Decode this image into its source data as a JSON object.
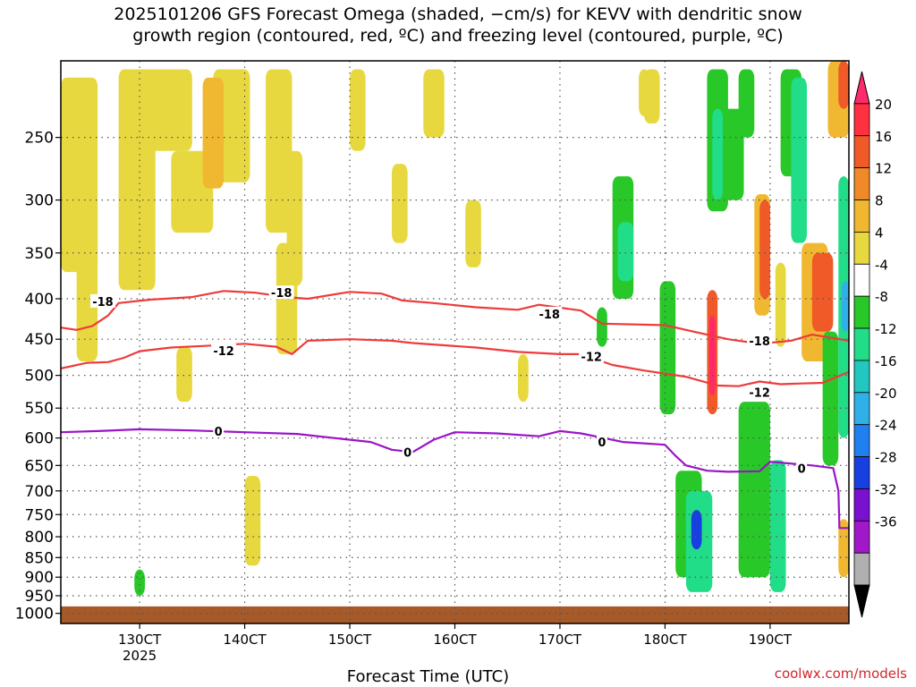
{
  "title": {
    "line1": "2025101206 GFS Forecast Omega (shaded, −cm/s) for KEVV with dendritic snow",
    "line2": "growth region (contoured, red, ºC) and freezing level (contoured, purple, ºC)"
  },
  "credit": "coolwx.com/models",
  "chart_data": {
    "type": "heatmap",
    "xlabel": "Forecast Time (UTC)",
    "x_ticks": [
      {
        "t": 30,
        "label": "130CT",
        "sub": "2025"
      },
      {
        "t": 40,
        "label": "140CT",
        "sub": ""
      },
      {
        "t": 50,
        "label": "150CT",
        "sub": ""
      },
      {
        "t": 60,
        "label": "160CT",
        "sub": ""
      },
      {
        "t": 70,
        "label": "170CT",
        "sub": ""
      },
      {
        "t": 80,
        "label": "180CT",
        "sub": ""
      },
      {
        "t": 90,
        "label": "190CT",
        "sub": ""
      }
    ],
    "x_range_days": [
      22.5,
      97.5
    ],
    "y_pressure_levels": [
      "250",
      "300",
      "350",
      "400",
      "450",
      "500",
      "550",
      "600",
      "650",
      "700",
      "750",
      "800",
      "850",
      "900",
      "950",
      "1000"
    ],
    "y_range_hpa": [
      200,
      1030
    ],
    "y_scale": "log-pressure",
    "colorbar": {
      "labels": [
        "20",
        "16",
        "12",
        "8",
        "4",
        "-4",
        "-8",
        "-12",
        "-16",
        "-20",
        "-24",
        "-28",
        "-32",
        "-36"
      ],
      "colors": [
        "#ff2a6a",
        "#ff3040",
        "#f05a28",
        "#f08a28",
        "#f0b830",
        "#e8d840",
        "#ffffff",
        "#28c828",
        "#22dd88",
        "#22c8c0",
        "#30b0e8",
        "#2080f0",
        "#1840e0",
        "#7a10d0",
        "#a018c8",
        "#b0b0b0",
        "#000000"
      ]
    },
    "contours": {
      "dendritic_minus18": {
        "label": "-18",
        "color": "#ee3b3b",
        "points": [
          [
            22.5,
            435
          ],
          [
            24,
            438
          ],
          [
            25.5,
            433
          ],
          [
            27,
            420
          ],
          [
            28,
            405
          ],
          [
            31,
            401
          ],
          [
            35,
            398
          ],
          [
            38,
            391
          ],
          [
            41,
            393
          ],
          [
            44,
            398
          ],
          [
            46,
            400
          ],
          [
            50,
            392
          ],
          [
            53,
            394
          ],
          [
            55,
            402
          ],
          [
            58,
            405
          ],
          [
            62,
            410
          ],
          [
            66,
            413
          ],
          [
            68,
            407
          ],
          [
            72,
            414
          ],
          [
            74,
            430
          ],
          [
            80,
            432
          ],
          [
            84,
            444
          ],
          [
            86,
            450
          ],
          [
            89,
            456
          ],
          [
            92,
            452
          ],
          [
            94,
            444
          ],
          [
            97.5,
            452
          ]
        ]
      },
      "dendritic_minus12": {
        "label": "-12",
        "color": "#ee3b3b",
        "points": [
          [
            22.5,
            490
          ],
          [
            25,
            482
          ],
          [
            27,
            481
          ],
          [
            28.5,
            475
          ],
          [
            30,
            466
          ],
          [
            33,
            461
          ],
          [
            36,
            459
          ],
          [
            40,
            456
          ],
          [
            43,
            460
          ],
          [
            44.5,
            470
          ],
          [
            46,
            452
          ],
          [
            50,
            450
          ],
          [
            54,
            452
          ],
          [
            56,
            455
          ],
          [
            62,
            461
          ],
          [
            66,
            467
          ],
          [
            70,
            470
          ],
          [
            72,
            470
          ],
          [
            75,
            485
          ],
          [
            78,
            493
          ],
          [
            82,
            502
          ],
          [
            85,
            515
          ],
          [
            87,
            516
          ],
          [
            89,
            509
          ],
          [
            91,
            513
          ],
          [
            93,
            512
          ],
          [
            95,
            511
          ],
          [
            97.5,
            495
          ]
        ]
      },
      "freezing_0": {
        "label": "0",
        "color": "#9a14c8",
        "points": [
          [
            22.5,
            590
          ],
          [
            26,
            588
          ],
          [
            30,
            585
          ],
          [
            35,
            587
          ],
          [
            40,
            590
          ],
          [
            45,
            593
          ],
          [
            49,
            601
          ],
          [
            52,
            607
          ],
          [
            54,
            621
          ],
          [
            56,
            625
          ],
          [
            58,
            603
          ],
          [
            60,
            590
          ],
          [
            64,
            592
          ],
          [
            68,
            597
          ],
          [
            70,
            588
          ],
          [
            72,
            592
          ],
          [
            76,
            607
          ],
          [
            80,
            612
          ],
          [
            81,
            632
          ],
          [
            82,
            650
          ],
          [
            84,
            660
          ],
          [
            86,
            662
          ],
          [
            89,
            661
          ],
          [
            90,
            643
          ],
          [
            94,
            650
          ],
          [
            96,
            655
          ],
          [
            96.5,
            700
          ],
          [
            96.6,
            780
          ],
          [
            97.5,
            780
          ]
        ]
      }
    },
    "contour_labels": [
      {
        "text": "-18",
        "t": 26.5,
        "p": 403
      },
      {
        "text": "-18",
        "t": 43.5,
        "p": 393
      },
      {
        "text": "-18",
        "t": 69,
        "p": 418
      },
      {
        "text": "-18",
        "t": 89,
        "p": 452
      },
      {
        "text": "-12",
        "t": 38,
        "p": 465
      },
      {
        "text": "-12",
        "t": 73,
        "p": 473
      },
      {
        "text": "-12",
        "t": 89,
        "p": 525
      },
      {
        "text": "0",
        "t": 37.5,
        "p": 588
      },
      {
        "text": "0",
        "t": 55.5,
        "p": 625
      },
      {
        "text": "0",
        "t": 74,
        "p": 607
      },
      {
        "text": "0",
        "t": 93,
        "p": 655
      }
    ],
    "omega_regions": [
      {
        "t0": 22.5,
        "t1": 26,
        "p0": 210,
        "p1": 370,
        "v": 5
      },
      {
        "t0": 24,
        "t1": 26,
        "p0": 300,
        "p1": 480,
        "v": 5
      },
      {
        "t0": 28,
        "t1": 31.5,
        "p0": 205,
        "p1": 390,
        "v": 5
      },
      {
        "t0": 30,
        "t1": 35,
        "p0": 205,
        "p1": 260,
        "v": 6
      },
      {
        "t0": 33,
        "t1": 37,
        "p0": 260,
        "p1": 330,
        "v": 5
      },
      {
        "t0": 33.5,
        "t1": 35,
        "p0": 460,
        "p1": 540,
        "v": 5
      },
      {
        "t0": 37,
        "t1": 40.5,
        "p0": 205,
        "p1": 285,
        "v": 5
      },
      {
        "t0": 42,
        "t1": 44.5,
        "p0": 205,
        "p1": 330,
        "v": 5
      },
      {
        "t0": 44,
        "t1": 45.5,
        "p0": 260,
        "p1": 385,
        "v": 5
      },
      {
        "t0": 43,
        "t1": 45,
        "p0": 340,
        "p1": 470,
        "v": 5
      },
      {
        "t0": 36,
        "t1": 38,
        "p0": 210,
        "p1": 290,
        "v": 9
      },
      {
        "t0": 50,
        "t1": 51.5,
        "p0": 205,
        "p1": 260,
        "v": 5
      },
      {
        "t0": 54,
        "t1": 55.5,
        "p0": 270,
        "p1": 340,
        "v": 5
      },
      {
        "t0": 57,
        "t1": 59,
        "p0": 205,
        "p1": 250,
        "v": 5
      },
      {
        "t0": 61,
        "t1": 62.5,
        "p0": 300,
        "p1": 365,
        "v": 5
      },
      {
        "t0": 66,
        "t1": 67,
        "p0": 470,
        "p1": 540,
        "v": 5
      },
      {
        "t0": 40,
        "t1": 41.5,
        "p0": 670,
        "p1": 870,
        "v": 5
      },
      {
        "t0": 29.5,
        "t1": 30.5,
        "p0": 880,
        "p1": 950,
        "v": -8
      },
      {
        "t0": 75,
        "t1": 77,
        "p0": 280,
        "p1": 400,
        "v": -8
      },
      {
        "t0": 75.5,
        "t1": 77,
        "p0": 320,
        "p1": 380,
        "v": -12
      },
      {
        "t0": 73.5,
        "t1": 74.5,
        "p0": 410,
        "p1": 460,
        "v": -8
      },
      {
        "t0": 77.5,
        "t1": 78.5,
        "p0": 205,
        "p1": 235,
        "v": 5
      },
      {
        "t0": 78,
        "t1": 79.5,
        "p0": 205,
        "p1": 240,
        "v": 5
      },
      {
        "t0": 79.5,
        "t1": 81,
        "p0": 380,
        "p1": 560,
        "v": -8
      },
      {
        "t0": 81,
        "t1": 83.5,
        "p0": 660,
        "p1": 900,
        "v": -8
      },
      {
        "t0": 82,
        "t1": 84.5,
        "p0": 700,
        "p1": 940,
        "v": -12
      },
      {
        "t0": 82.5,
        "t1": 83.5,
        "p0": 740,
        "p1": 830,
        "v": -24
      },
      {
        "t0": 84,
        "t1": 85,
        "p0": 390,
        "p1": 560,
        "v": 12
      },
      {
        "t0": 84.2,
        "t1": 84.8,
        "p0": 420,
        "p1": 530,
        "v": 20
      },
      {
        "t0": 84,
        "t1": 86,
        "p0": 205,
        "p1": 310,
        "v": -8
      },
      {
        "t0": 84.5,
        "t1": 85.5,
        "p0": 230,
        "p1": 300,
        "v": -12
      },
      {
        "t0": 85.5,
        "t1": 87.5,
        "p0": 230,
        "p1": 300,
        "v": -8
      },
      {
        "t0": 87,
        "t1": 88.5,
        "p0": 205,
        "p1": 250,
        "v": -8
      },
      {
        "t0": 88.5,
        "t1": 90,
        "p0": 295,
        "p1": 420,
        "v": 8
      },
      {
        "t0": 89,
        "t1": 90,
        "p0": 300,
        "p1": 400,
        "v": 12
      },
      {
        "t0": 87,
        "t1": 90,
        "p0": 540,
        "p1": 900,
        "v": -8
      },
      {
        "t0": 90,
        "t1": 91.5,
        "p0": 640,
        "p1": 940,
        "v": -12
      },
      {
        "t0": 90.5,
        "t1": 91.5,
        "p0": 360,
        "p1": 460,
        "v": 5
      },
      {
        "t0": 91,
        "t1": 93,
        "p0": 205,
        "p1": 280,
        "v": -8
      },
      {
        "t0": 92,
        "t1": 93.5,
        "p0": 210,
        "p1": 340,
        "v": -12
      },
      {
        "t0": 93,
        "t1": 95.5,
        "p0": 340,
        "p1": 480,
        "v": 8
      },
      {
        "t0": 94,
        "t1": 96,
        "p0": 350,
        "p1": 440,
        "v": 12
      },
      {
        "t0": 95,
        "t1": 96.5,
        "p0": 440,
        "p1": 650,
        "v": -8
      },
      {
        "t0": 95.5,
        "t1": 97.5,
        "p0": 200,
        "p1": 250,
        "v": 8
      },
      {
        "t0": 96.5,
        "t1": 97.5,
        "p0": 200,
        "p1": 230,
        "v": 12
      },
      {
        "t0": 96.5,
        "t1": 97.5,
        "p0": 280,
        "p1": 600,
        "v": -12
      },
      {
        "t0": 96.8,
        "t1": 97.5,
        "p0": 380,
        "p1": 440,
        "v": -20
      },
      {
        "t0": 96.5,
        "t1": 97.5,
        "p0": 760,
        "p1": 900,
        "v": 8
      }
    ],
    "ground_pressure": 980
  }
}
